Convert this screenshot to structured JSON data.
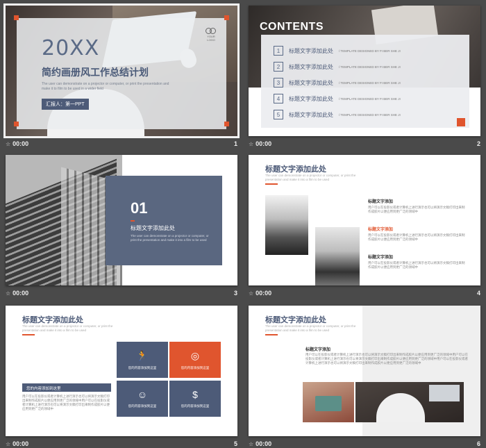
{
  "slides": [
    {
      "id": 1,
      "time": "00:00",
      "number": "1",
      "big": "20XX",
      "title": "简约画册风工作总结计划",
      "subtitle": "The user can demonstrate on a projector or computer, or print the presentation and make it to film to be used in a wider field",
      "presenter": "汇报人：第一PPT",
      "logo": "YOUR LOGO"
    },
    {
      "id": 2,
      "time": "00:00",
      "number": "2",
      "heading": "CONTENTS",
      "items": [
        {
          "n": "1",
          "text": "标题文字添加此处",
          "desc": "TEMPLATE DESIGNED BY FI BER SHE JI"
        },
        {
          "n": "2",
          "text": "标题文字添加此处",
          "desc": "TEMPLATE DESIGNED BY FI BER SHE JI"
        },
        {
          "n": "3",
          "text": "标题文字添加此处",
          "desc": "TEMPLATE DESIGNED BY FI BER SHE JI"
        },
        {
          "n": "4",
          "text": "标题文字添加此处",
          "desc": "TEMPLATE DESIGNED BY FI BER SHE JI"
        },
        {
          "n": "5",
          "text": "标题文字添加此处",
          "desc": "TEMPLATE DESIGNED BY FI BER SHE JI"
        }
      ]
    },
    {
      "id": 3,
      "time": "00:00",
      "number": "3",
      "section": "01",
      "title": "标题文字添加此处",
      "subtitle": "The user can demonstrate on a projector or computer, or print the presentation and make it into a film to be used"
    },
    {
      "id": 4,
      "time": "00:00",
      "number": "4",
      "title": "标题文字添加此处",
      "subtitle": "The user can demonstrate on a projector or computer, or print the presentation and make it into a film to be used",
      "blocks": [
        {
          "h": "标题文字添加",
          "b": "用户可以在投影仪或者计算机上进行演示也可以将演示文稿打印出来制作成胶片以便应用到更广泛的领域中"
        },
        {
          "h": "标题文字添加",
          "b": "用户可以在投影仪或者计算机上进行演示也可以将演示文稿打印出来制作成胶片以便应用到更广泛的领域中"
        },
        {
          "h": "标题文字添加",
          "b": "用户可以在投影仪或者计算机上进行演示也可以将演示文稿打印出来制作成胶片以便应用到更广泛的领域中"
        }
      ]
    },
    {
      "id": 5,
      "time": "00:00",
      "number": "5",
      "title": "标题文字添加此处",
      "subtitle": "The user can demonstrate on a projector or computer, or print the presentation and make it into a film to be used",
      "cards": [
        "您的内容添加到这里",
        "您的内容添加到这里",
        "您的内容添加到这里",
        "您的内容添加到这里"
      ],
      "box_title": "您的内容添加到这里",
      "box_body": "用户可以在投影仪或者计算机上进行演示也可以将演示文稿打印出来制作成胶片以便应用到更广泛的领域中用户可以在投影仪或者计算机上进行演示也可以将演示文稿打印出来制作成胶片以便应用到更广泛的领域中"
    },
    {
      "id": 6,
      "time": "00:00",
      "number": "6",
      "title": "标题文字添加此处",
      "subtitle": "The user can demonstrate on a projector or computer, or print the presentation and make it into a film to be used",
      "block_title": "标题文字添加",
      "block_body": "用户可以在投影仪或者计算机上进行演示也可以将演示文稿打印出来制作成胶片以便应用到更广泛的领域中用户可以在投影仪或者计算机上进行演示也可以将演示文稿打印出来制作成胶片以便应用到更广泛的领域中用户可以在投影仪或者计算机上进行演示也可以将演示文稿打印出来制作成胶片以便应用到更广泛的领域中"
    }
  ],
  "colors": {
    "accent": "#e0552e",
    "navy": "#4d5b78",
    "background": "#4a4a4a"
  },
  "icons": {
    "slide_meta": "transition-star-icon",
    "card1": "running-person-icon",
    "card2": "target-icon",
    "card3": "brain-head-icon",
    "card4": "money-bag-icon"
  }
}
